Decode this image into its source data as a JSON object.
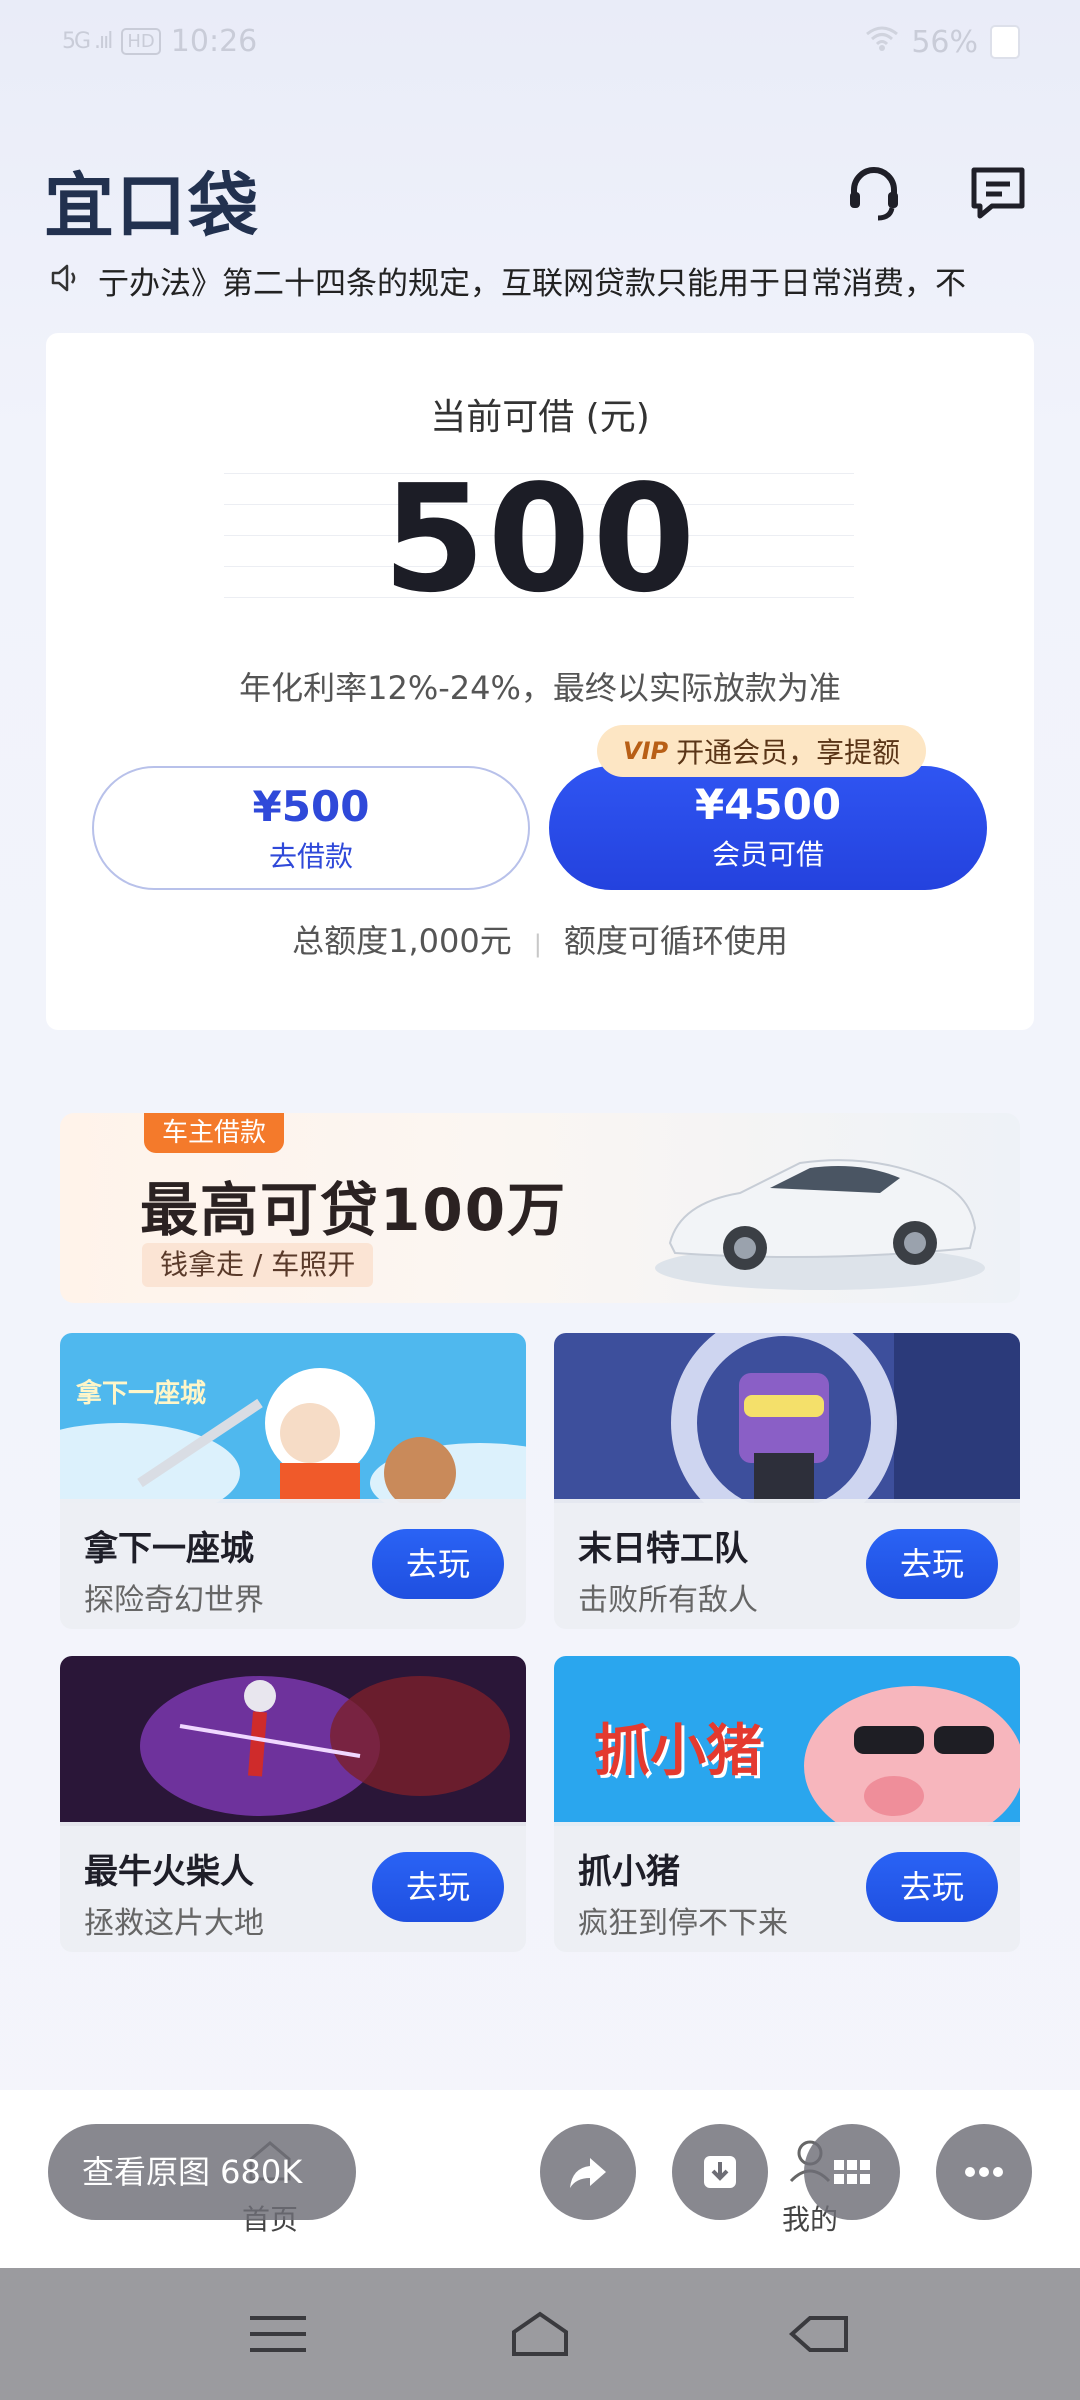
{
  "status_bar": {
    "signal": "5G .ııl",
    "hd": "HD",
    "time": "10:26",
    "battery": "56%"
  },
  "header": {
    "logo": "宜口袋",
    "service_icon": "headset-icon",
    "message_icon": "message-icon"
  },
  "notice": {
    "icon": "speaker-icon",
    "text": "亍办法》第二十四条的规定，互联网贷款只能用于日常消费，不"
  },
  "loan_card": {
    "title": "当前可借 (元)",
    "amount": "500",
    "rate_note": "年化利率12%-24%，最终以实际放款为准",
    "borrow_button": {
      "amount": "¥500",
      "label": "去借款"
    },
    "vip_tag": {
      "mark": "VIP",
      "text": "开通会员，享提额"
    },
    "vip_button": {
      "amount": "¥4500",
      "label": "会员可借"
    },
    "total_limit": "总额度1,000元",
    "limit_note": "额度可循环使用"
  },
  "banner": {
    "tag": "车主借款",
    "title": "最高可贷100万",
    "subtitle": "钱拿走 / 车照开"
  },
  "games": [
    {
      "name": "拿下一座城",
      "desc": "探险奇幻世界",
      "art_text": "拿下一座城",
      "button": "去玩"
    },
    {
      "name": "末日特工队",
      "desc": "击败所有敌人",
      "button": "去玩"
    },
    {
      "name": "最牛火柴人",
      "desc": "拯救这片大地",
      "button": "去玩"
    },
    {
      "name": "抓小猪",
      "desc": "疯狂到停不下来",
      "art_text": "抓小猪",
      "button": "去玩"
    }
  ],
  "bottom_tabs": {
    "home": "首页",
    "mine": "我的"
  },
  "overlay": {
    "view_original": "查看原图 680K"
  },
  "colors": {
    "primary": "#2a4fe4",
    "logo": "#22314f",
    "vip_tag_bg": "#fde6c4",
    "banner_tag": "#f47a2b"
  }
}
